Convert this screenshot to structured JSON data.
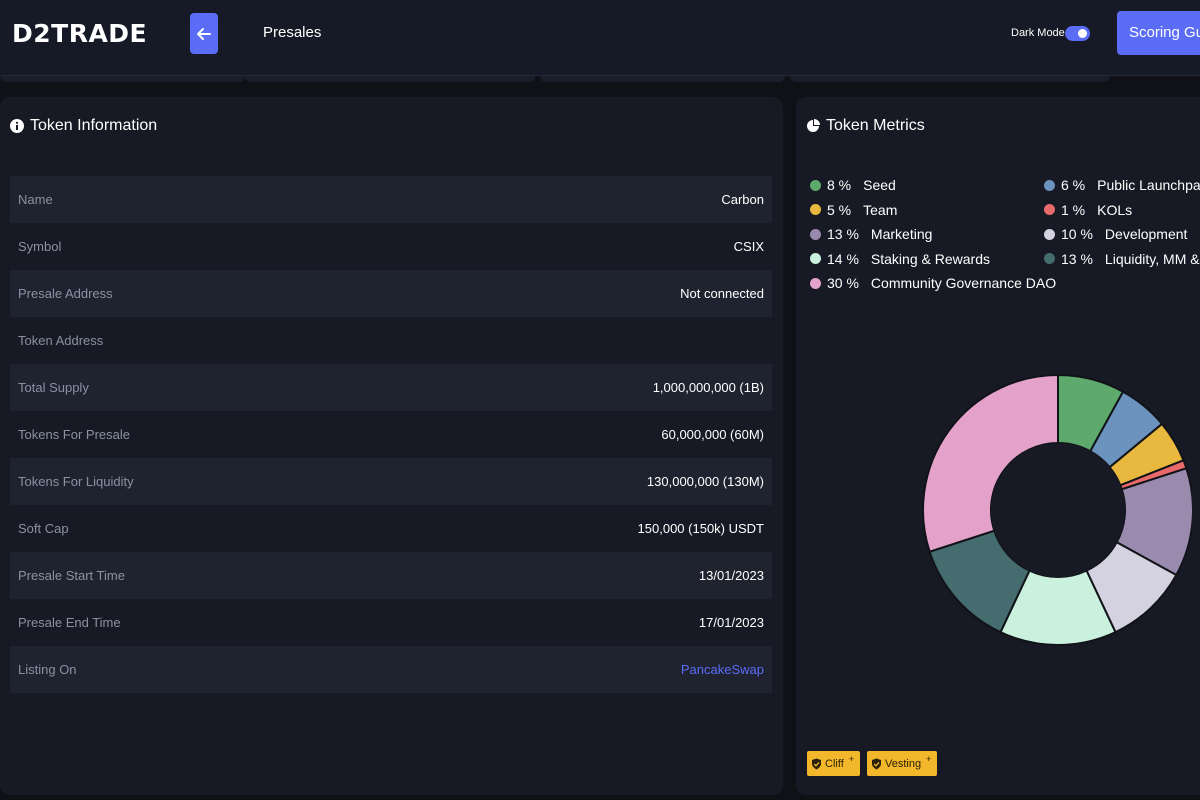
{
  "header": {
    "logo": "D2TRADE",
    "page_title": "Presales",
    "dark_mode_label": "Dark Mode",
    "dark_mode_on": true,
    "scoring_button": "Scoring Guide",
    "accent": "#5b6cf6"
  },
  "token_info": {
    "title": "Token Information",
    "rows": [
      {
        "key": "Name",
        "value": "Carbon"
      },
      {
        "key": "Symbol",
        "value": "CSIX"
      },
      {
        "key": "Presale Address",
        "value": "Not connected"
      },
      {
        "key": "Token Address",
        "value": ""
      },
      {
        "key": "Total Supply",
        "value": "1,000,000,000 (1B)"
      },
      {
        "key": "Tokens For Presale",
        "value": "60,000,000 (60M)"
      },
      {
        "key": "Tokens For Liquidity",
        "value": "130,000,000 (130M)"
      },
      {
        "key": "Soft Cap",
        "value": "150,000 (150k) USDT"
      },
      {
        "key": "Presale Start Time",
        "value": "13/01/2023"
      },
      {
        "key": "Presale End Time",
        "value": "17/01/2023"
      },
      {
        "key": "Listing On",
        "value": "PancakeSwap"
      }
    ]
  },
  "token_metrics": {
    "title": "Token Metrics",
    "legend": [
      {
        "pct": "8 %",
        "label": "Seed",
        "color": "#5daa6c"
      },
      {
        "pct": "6 %",
        "label": "Public Launchpads",
        "color": "#6b93bd"
      },
      {
        "pct": "5 %",
        "label": "Team",
        "color": "#e8b83f"
      },
      {
        "pct": "1 %",
        "label": "KOLs",
        "color": "#e86a6a"
      },
      {
        "pct": "13 %",
        "label": "Marketing",
        "color": "#9a8aae"
      },
      {
        "pct": "10 %",
        "label": "Development",
        "color": "#d4d1e0"
      },
      {
        "pct": "14 %",
        "label": "Staking & Rewards",
        "color": "#c9f1dd"
      },
      {
        "pct": "13 %",
        "label": "Liquidity, MM & Listing",
        "color": "#456c6e"
      },
      {
        "pct": "30 %",
        "label": "Community Governance DAO",
        "color": "#e4a2cb"
      }
    ],
    "badges": [
      {
        "label": "Cliff"
      },
      {
        "label": "Vesting"
      }
    ]
  },
  "chart_data": {
    "type": "pie",
    "categories": [
      "Seed",
      "Public Launchpads",
      "Team",
      "KOLs",
      "Marketing",
      "Development",
      "Staking & Rewards",
      "Liquidity, MM & Listing",
      "Community Governance DAO"
    ],
    "values": [
      8,
      6,
      5,
      1,
      13,
      10,
      14,
      13,
      30
    ],
    "colors": [
      "#5daa6c",
      "#6b93bd",
      "#e8b83f",
      "#e86a6a",
      "#9a8aae",
      "#d4d1e0",
      "#c9f1dd",
      "#456c6e",
      "#e4a2cb"
    ],
    "donut": true
  }
}
